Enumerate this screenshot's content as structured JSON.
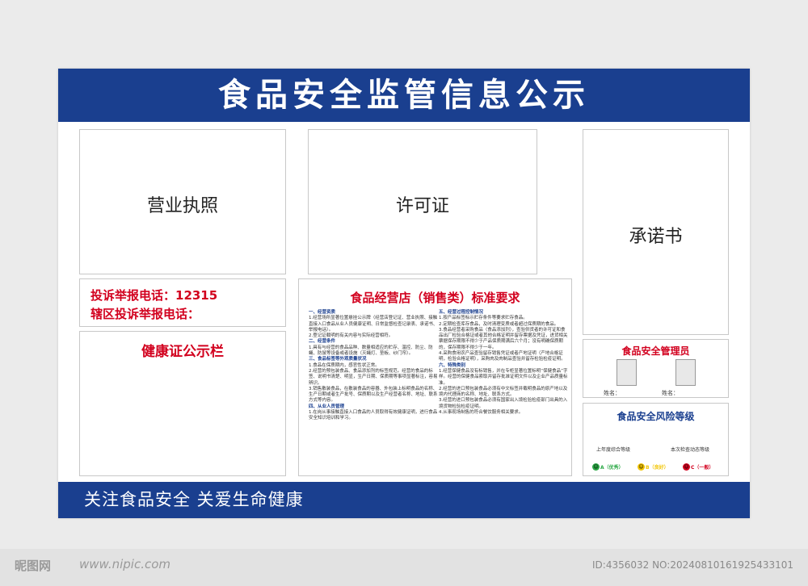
{
  "header": {
    "title": "食品安全监管信息公示"
  },
  "panels": {
    "business_license": "营业执照",
    "permit": "许可证",
    "commitment": "承诺书"
  },
  "contact": {
    "complaint_line": "投诉举报电话：12315",
    "district_line": "辖区投诉举报电话："
  },
  "health_board": {
    "title": "健康证公示栏"
  },
  "standards": {
    "title": "食品经营店（销售类）标准要求",
    "left": [
      {
        "h": "一、经营资质"
      },
      {
        "t": "1.经营场所显著位置悬挂公示牌（经营店登记证、营业执照、接触直接入口食品从业人员健康证明、日常监督检查记录表、承诺书、举报电话）。"
      },
      {
        "t": "2.登记证载明的有关内容与实际经营相符。"
      },
      {
        "h": "二、经营条件"
      },
      {
        "t": "1.具有与经营的食品品种、数量相适应的贮存、温控、防尘、防蝇、防鼠等设备或者设施（灭蝇灯、垫板、纱门帘）。"
      },
      {
        "h": "三、食品标签等外观质量状况"
      },
      {
        "t": "1.食品在保质期内，感官性状正常。"
      },
      {
        "t": "2.经营的预包装食品、食品添加剂的标签规范。经营的食品的标签、说明书清楚、明显，生产日期、保质期等事项显著标注，容易辨识。"
      },
      {
        "t": "3.销售散装食品，在散装食品的容器、外包装上标明食品的名称、生产日期或者生产批号、保质期以及生产经营者名称、地址、联系方式等内容。"
      },
      {
        "h": "四、从业人员管理"
      },
      {
        "t": "1.在岗从事接触直接入口食品的人员取得有效健康证明，进行食品安全知识培训和学习。"
      }
    ],
    "right": [
      {
        "h": "五、经营过程控制情况"
      },
      {
        "t": "1.按产品标签标示贮存条件等要求贮存食品。"
      },
      {
        "t": "2.定期检查库存食品，及时清理变质或者超过保质期的食品。"
      },
      {
        "t": "3.食品经营者采购食品（食品添加剂），查验供货者的许可证和食品出厂检验合格证或者其他合格证明并留存票据及凭证，进货相关票据保存期限不得少于产品保质期满后六个月；没有明确保质期的，保存期限不得少于一年。"
      },
      {
        "t": "4.采购食用农产品查验留存销售凭证或者产地证明（产地合格证明，检验合格证明），采购肉及肉制品查验并留存检验检疫证明。"
      },
      {
        "h": "六、特殊类别"
      },
      {
        "t": "1.经营保健食品没有标销售，并在专柜显著位置标明“保健食品”字样。经营的保健食品索取并留存批准证明文件以及企业产品质量标准。"
      },
      {
        "t": "2.经营的进口预包装食品必须有中文标签并载明食品的原产地以及境内代理商的名称、地址、联系方式。"
      },
      {
        "t": "3.经营的进口预包装食品必须有国家出入境检验检疫部门出具的入境货物检验检疫证明。"
      },
      {
        "t": "4.从事现场制售的符合餐饮服务相关要求。"
      }
    ]
  },
  "manager": {
    "title": "食品安全管理员",
    "name_label": "姓名："
  },
  "risk": {
    "title": "食品安全风险等级",
    "last_year": "上年度综合等级",
    "this_time": "本次检查动态等级",
    "levels": [
      {
        "letter": "A",
        "label": "（优秀）",
        "color": "#2aa845"
      },
      {
        "letter": "B",
        "label": "（良好）",
        "color": "#f2c400"
      },
      {
        "letter": "C",
        "label": "（一般）",
        "color": "#d2001e"
      }
    ]
  },
  "footer": {
    "slogan": "关注食品安全  关爱生命健康"
  },
  "watermark": {
    "logo": "昵图网",
    "site": "www.nipic.com",
    "id": "ID:4356032 NO:20240810161925433101"
  }
}
